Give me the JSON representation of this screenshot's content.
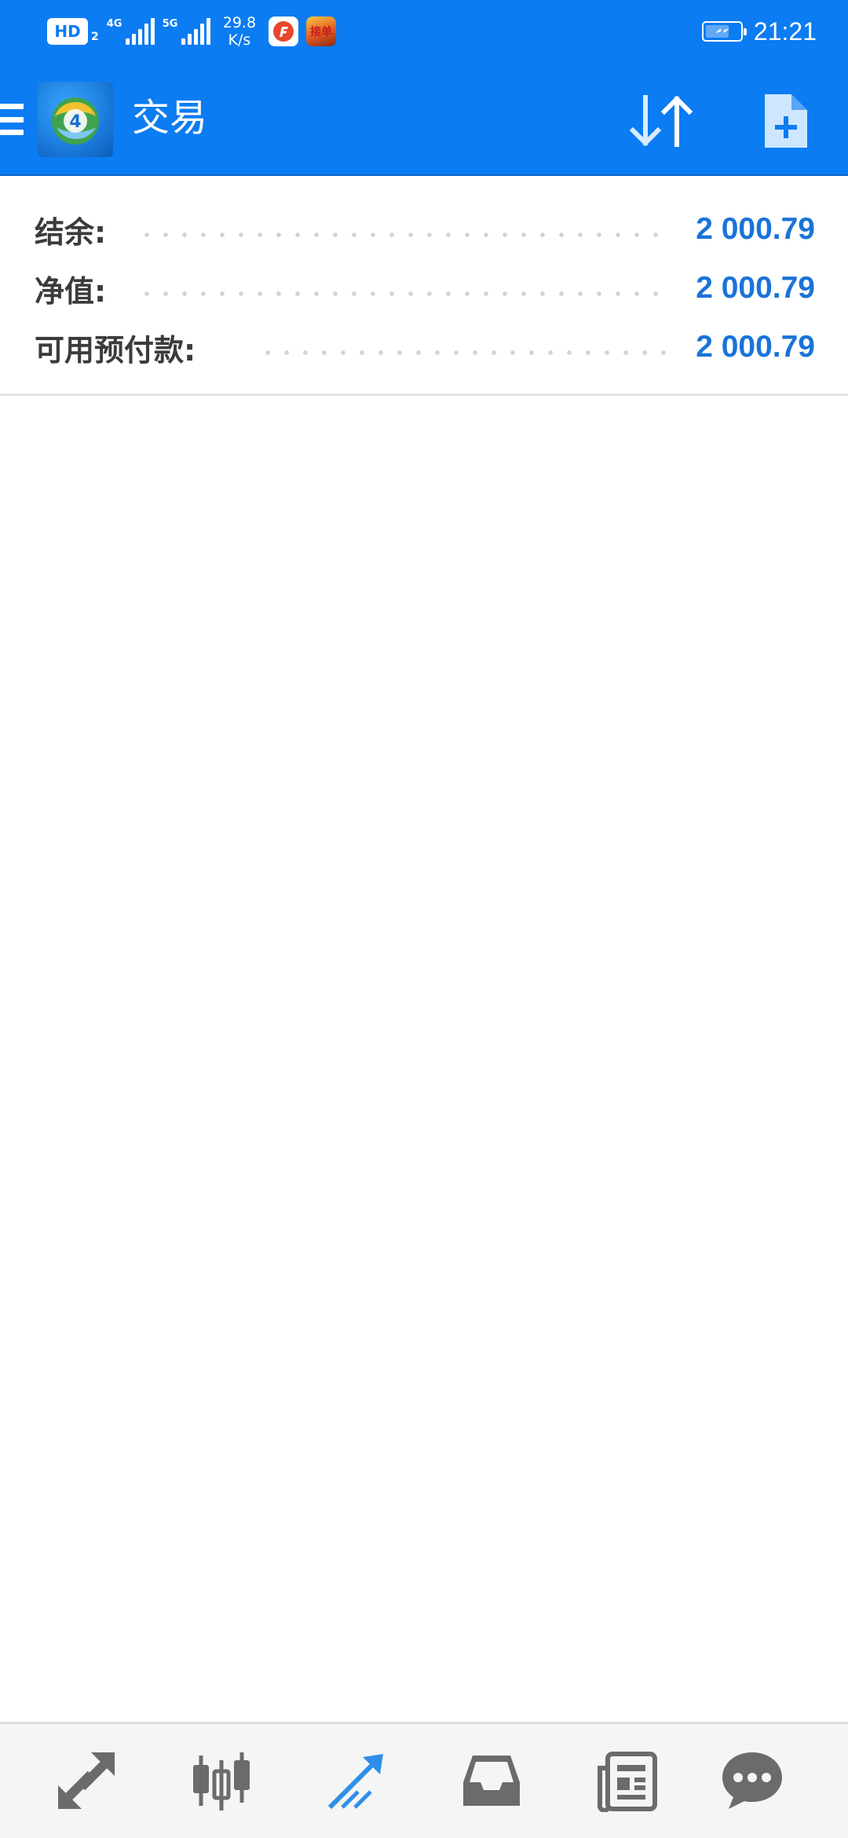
{
  "status_bar": {
    "hd_label": "HD",
    "hd_sub": "2",
    "signal_1_label": "4G",
    "signal_2_label": "5G",
    "speed_value": "29.8",
    "speed_unit": "K/s",
    "app_icon_b_label": "接单",
    "time": "21:21"
  },
  "app_bar": {
    "title": "交易",
    "logo_badge": "4"
  },
  "account": {
    "rows": [
      {
        "label": "结余:",
        "value": "2 000.79"
      },
      {
        "label": "净值:",
        "value": "2 000.79"
      },
      {
        "label": "可用预付款:",
        "value": "2 000.79"
      }
    ]
  },
  "bottom_nav": {
    "active_index": 2,
    "items": [
      {
        "icon": "quotes-icon"
      },
      {
        "icon": "chart-icon"
      },
      {
        "icon": "trade-icon"
      },
      {
        "icon": "history-icon"
      },
      {
        "icon": "news-icon"
      },
      {
        "icon": "messages-icon"
      }
    ]
  },
  "colors": {
    "primary": "#0b7cf2",
    "value_blue": "#1a73d9",
    "label_text": "#3b3b3b",
    "nav_icon": "#6b6b6b",
    "nav_icon_active": "#2f8fe8"
  }
}
